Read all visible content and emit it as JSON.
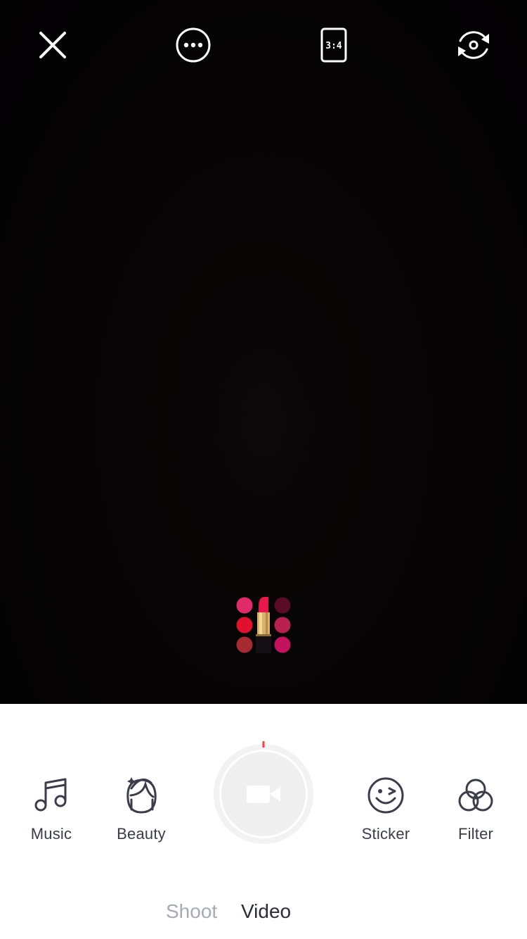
{
  "top_bar": {
    "close_icon": "close-icon",
    "more_icon": "more-options-icon",
    "ratio_label": "3:4",
    "flip_icon": "flip-camera-icon"
  },
  "viewfinder": {
    "sticker_icon": "lipstick-palette-icon"
  },
  "tools": {
    "music": "Music",
    "beauty": "Beauty",
    "sticker": "Sticker",
    "filter": "Filter"
  },
  "modes": {
    "shoot": "Shoot",
    "video": "Video",
    "active": "Video"
  },
  "colors": {
    "viewfinder_bg": "#050304",
    "icon_dark": "#3b3e4a",
    "mode_inactive": "#a8aab2",
    "mode_active": "#2b2d38",
    "record_ring": "#f0f0f0",
    "record_marker": "#ff3b4a"
  }
}
